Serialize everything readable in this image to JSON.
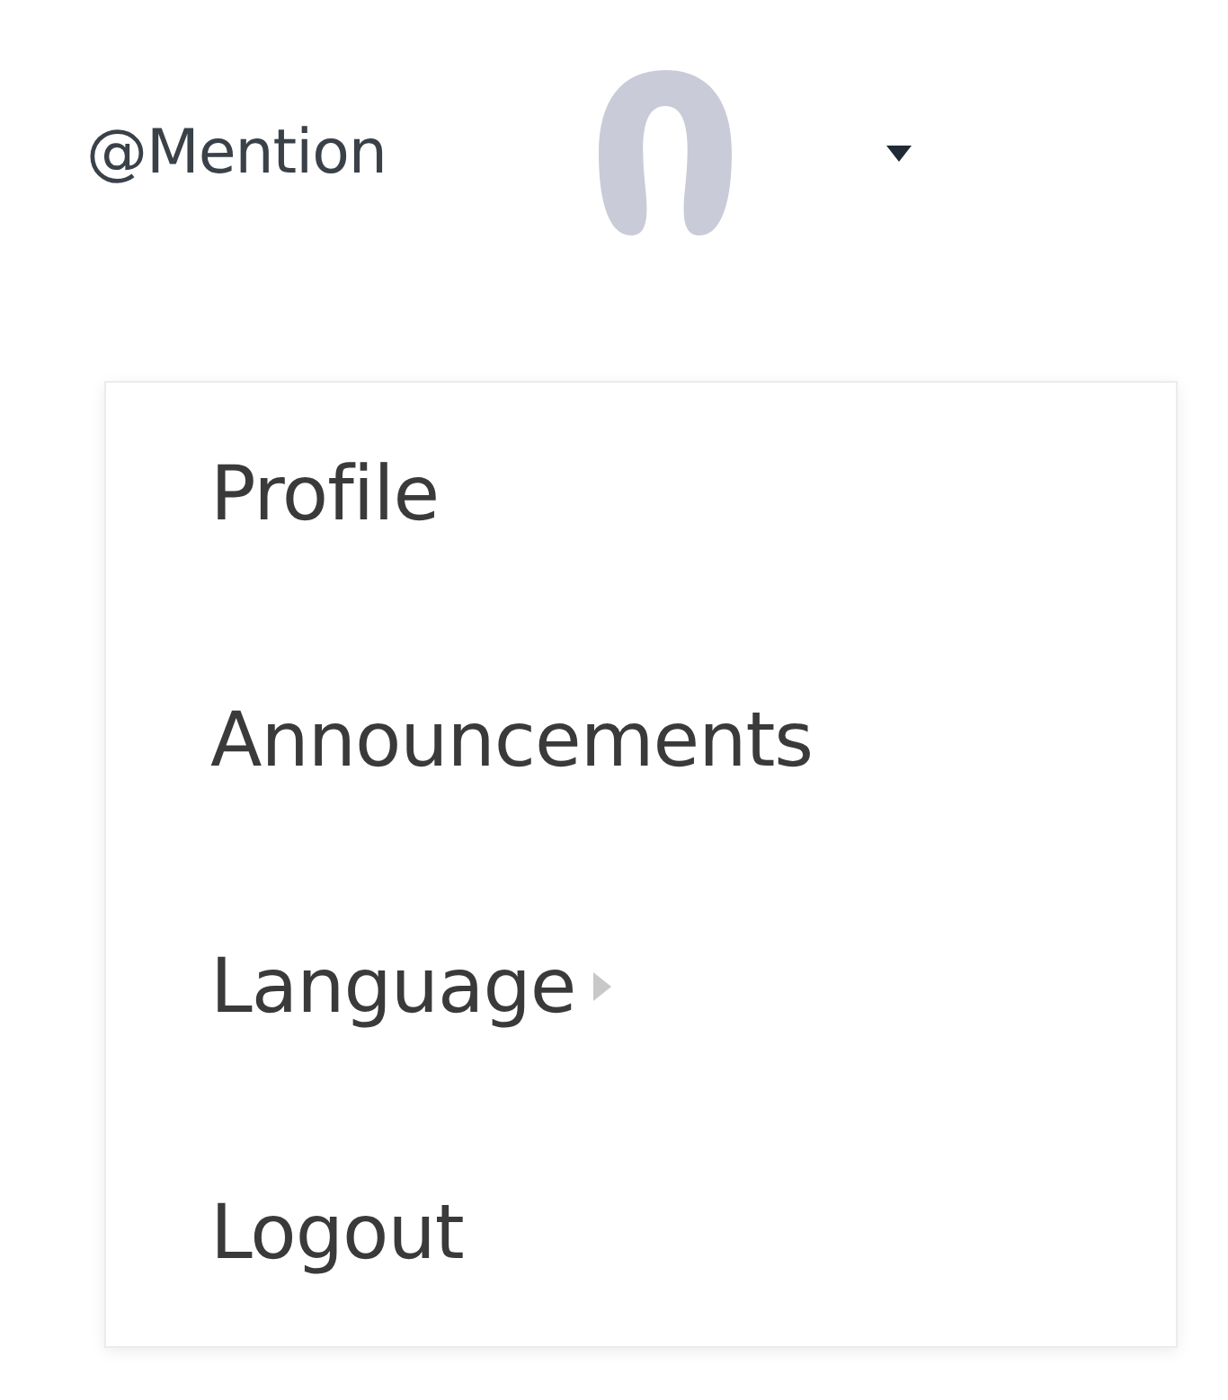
{
  "header": {
    "mention_link": "@Mention"
  },
  "menu": {
    "items": [
      {
        "label": "Profile",
        "has_submenu": false
      },
      {
        "label": "Announcements",
        "has_submenu": false
      },
      {
        "label": "Language",
        "has_submenu": true
      },
      {
        "label": "Logout",
        "has_submenu": false
      }
    ]
  }
}
